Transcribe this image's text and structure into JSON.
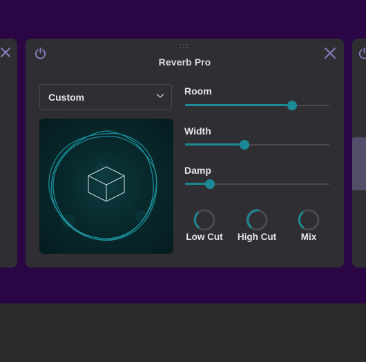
{
  "plugin": {
    "title": "Reverb Pro",
    "preset": "Custom",
    "sliders": [
      {
        "label": "Room",
        "value": 0.74
      },
      {
        "label": "Width",
        "value": 0.41
      },
      {
        "label": "Damp",
        "value": 0.17
      }
    ],
    "knobs": [
      {
        "label": "Low Cut"
      },
      {
        "label": "High Cut"
      },
      {
        "label": "Mix"
      }
    ]
  },
  "icons": {
    "power": "power-icon",
    "close": "close-icon",
    "drag": "drag-handle-icon",
    "dropdown": "chevron-down-icon",
    "cube": "cube-icon"
  },
  "colors": {
    "accent": "#1b8a96",
    "icon": "#8d7bbf",
    "background": "#2b0644",
    "panel": "#2f2f33"
  }
}
